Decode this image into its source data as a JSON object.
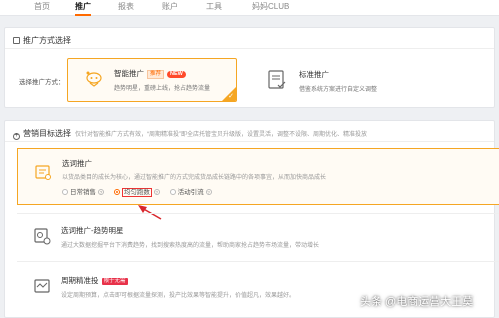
{
  "topnav": {
    "tabs": [
      {
        "label": "首页"
      },
      {
        "label": "推广"
      },
      {
        "label": "报表"
      },
      {
        "label": "账户"
      },
      {
        "label": "工具"
      },
      {
        "label": "妈妈CLUB"
      }
    ],
    "active_index": 1
  },
  "promo_method": {
    "section_title": "推广方式选择",
    "select_label": "选择推广方式：",
    "smart": {
      "title": "智能推广",
      "badge_rec": "推荐",
      "badge_new": "NEW",
      "desc": "趋势明星，重磅上线，抢占趋势流量",
      "selected": true
    },
    "standard": {
      "title": "标准推广",
      "desc": "借鉴系统方案进行自定义调整"
    }
  },
  "marketing_goal": {
    "section_title": "营销目标选择",
    "hint": "仅针对智能推广方式有效，“周期精准投”即全店托管宝贝升级版，设置灵活，调整不设限、周期优化、精准投放",
    "options": [
      {
        "title": "选词推广",
        "desc": "以货品类目的成长为核心，通过智能推广的方式完成货品成长链路中的各项事宜，从而加快商品成长",
        "radios": [
          {
            "label": "日常销售",
            "checked": false
          },
          {
            "label": "均匀跑数",
            "checked": true
          },
          {
            "label": "活动引流",
            "checked": false
          }
        ]
      },
      {
        "title": "选词推广-趋势明星",
        "desc": "通过大数据挖掘平台下消费趋势，找到搜索热度高的流量，帮助商家抢占趋势市场流量，带动增长"
      },
      {
        "title": "周期精准投",
        "badge": "限于无需",
        "desc": "设定周期预算，点击即可根据流量探测，投产比效果等智能提升，价值超凡，效果越好。"
      }
    ]
  },
  "watermark": "头条 @电商运营大王莫",
  "colors": {
    "accent": "#ff6a00",
    "card_border": "#f5a623",
    "arrow": "#d9262c",
    "badge_red": "#e8324a"
  }
}
